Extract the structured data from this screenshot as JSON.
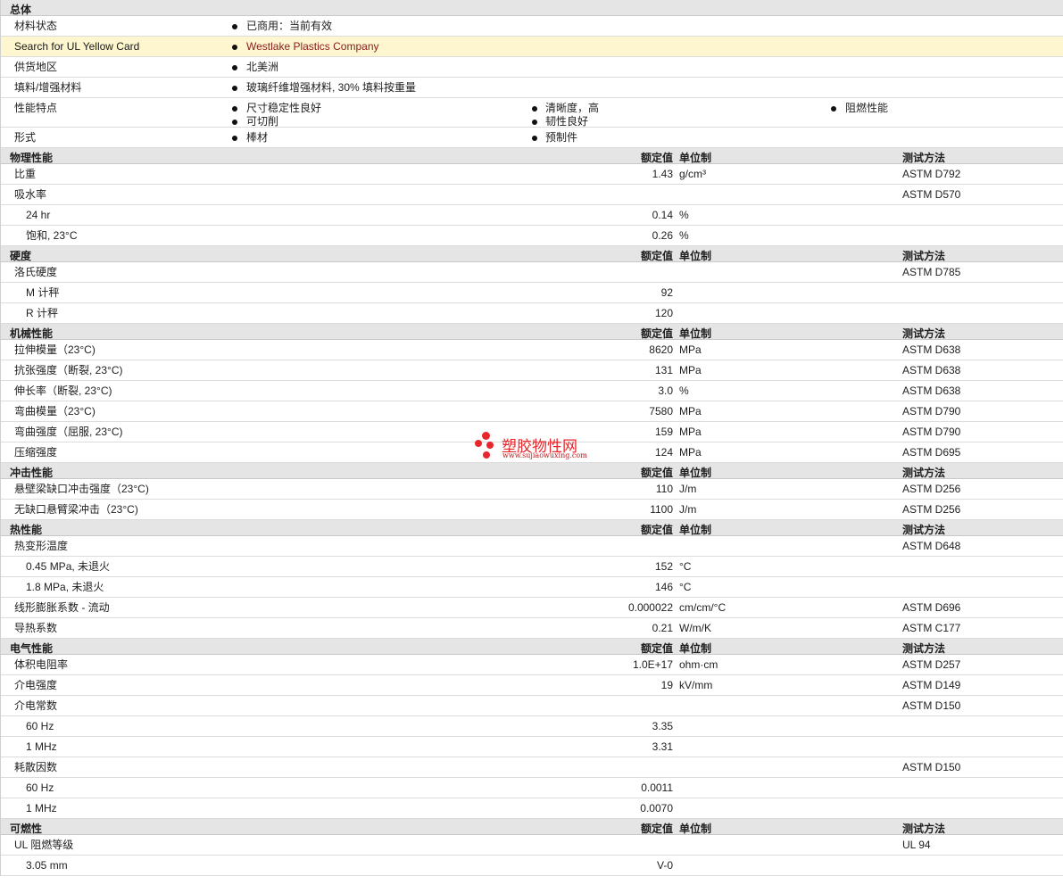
{
  "general": {
    "header": "总体",
    "rows": [
      {
        "label": "材料状态",
        "items": [
          "已商用：当前有效"
        ]
      },
      {
        "label": "Search for UL Yellow Card",
        "items": [
          "Westlake Plastics Company"
        ],
        "highlight": true
      },
      {
        "label": "供货地区",
        "items": [
          "北美洲"
        ]
      },
      {
        "label": "填料/增强材料",
        "items": [
          "玻璃纤维增强材料, 30% 填料按重量"
        ]
      },
      {
        "label": "性能特点",
        "items": [
          "尺寸稳定性良好",
          "清晰度，高",
          "阻燃性能",
          "可切削",
          "韧性良好"
        ]
      },
      {
        "label": "形式",
        "items": [
          "棒材",
          "预制件"
        ]
      }
    ]
  },
  "column_headers": {
    "value": "额定值",
    "unit": "单位制",
    "method": "测试方法"
  },
  "sections": [
    {
      "title": "物理性能",
      "rows": [
        {
          "label": "比重",
          "value": "1.43",
          "unit": "g/cm³",
          "method": "ASTM D792"
        },
        {
          "label": "吸水率",
          "value": "",
          "unit": "",
          "method": "ASTM D570"
        },
        {
          "label": "24 hr",
          "value": "0.14",
          "unit": "%",
          "method": "",
          "sub": true
        },
        {
          "label": "饱和, 23°C",
          "value": "0.26",
          "unit": "%",
          "method": "",
          "sub": true
        }
      ]
    },
    {
      "title": "硬度",
      "rows": [
        {
          "label": "洛氏硬度",
          "value": "",
          "unit": "",
          "method": "ASTM D785"
        },
        {
          "label": "M 计秤",
          "value": "92",
          "unit": "",
          "method": "",
          "sub": true
        },
        {
          "label": "R 计秤",
          "value": "120",
          "unit": "",
          "method": "",
          "sub": true
        }
      ]
    },
    {
      "title": "机械性能",
      "rows": [
        {
          "label": "拉伸模量（23°C)",
          "value": "8620",
          "unit": "MPa",
          "method": "ASTM D638"
        },
        {
          "label": "抗张强度（断裂, 23°C)",
          "value": "131",
          "unit": "MPa",
          "method": "ASTM D638"
        },
        {
          "label": "伸长率（断裂, 23°C)",
          "value": "3.0",
          "unit": "%",
          "method": "ASTM D638"
        },
        {
          "label": "弯曲模量（23°C)",
          "value": "7580",
          "unit": "MPa",
          "method": "ASTM D790"
        },
        {
          "label": "弯曲强度（屈服, 23°C)",
          "value": "159",
          "unit": "MPa",
          "method": "ASTM D790"
        },
        {
          "label": "压缩强度",
          "value": "124",
          "unit": "MPa",
          "method": "ASTM D695"
        }
      ]
    },
    {
      "title": "冲击性能",
      "rows": [
        {
          "label": "悬壁梁缺口冲击强度（23°C)",
          "value": "110",
          "unit": "J/m",
          "method": "ASTM D256"
        },
        {
          "label": "无缺口悬臂梁冲击（23°C)",
          "value": "1100",
          "unit": "J/m",
          "method": "ASTM D256"
        }
      ]
    },
    {
      "title": "热性能",
      "rows": [
        {
          "label": "热变形温度",
          "value": "",
          "unit": "",
          "method": "ASTM D648"
        },
        {
          "label": "0.45 MPa, 未退火",
          "value": "152",
          "unit": "°C",
          "method": "",
          "sub": true
        },
        {
          "label": "1.8 MPa, 未退火",
          "value": "146",
          "unit": "°C",
          "method": "",
          "sub": true
        },
        {
          "label": "线形膨胀系数 - 流动",
          "value": "0.000022",
          "unit": "cm/cm/°C",
          "method": "ASTM D696"
        },
        {
          "label": "导热系数",
          "value": "0.21",
          "unit": "W/m/K",
          "method": "ASTM C177"
        }
      ]
    },
    {
      "title": "电气性能",
      "rows": [
        {
          "label": "体积电阻率",
          "value": "1.0E+17",
          "unit": "ohm·cm",
          "method": "ASTM D257"
        },
        {
          "label": "介电强度",
          "value": "19",
          "unit": "kV/mm",
          "method": "ASTM D149"
        },
        {
          "label": "介电常数",
          "value": "",
          "unit": "",
          "method": "ASTM D150"
        },
        {
          "label": "60 Hz",
          "value": "3.35",
          "unit": "",
          "method": "",
          "sub": true
        },
        {
          "label": "1 MHz",
          "value": "3.31",
          "unit": "",
          "method": "",
          "sub": true
        },
        {
          "label": "耗散因数",
          "value": "",
          "unit": "",
          "method": "ASTM D150"
        },
        {
          "label": "60 Hz",
          "value": "0.0011",
          "unit": "",
          "method": "",
          "sub": true
        },
        {
          "label": "1 MHz",
          "value": "0.0070",
          "unit": "",
          "method": "",
          "sub": true
        }
      ]
    },
    {
      "title": "可燃性",
      "rows": [
        {
          "label": "UL 阻燃等级",
          "value": "",
          "unit": "",
          "method": "UL 94"
        },
        {
          "label": "3.05 mm",
          "value": "V-0",
          "unit": "",
          "method": "",
          "sub": true
        }
      ]
    }
  ],
  "watermark": {
    "name": "塑胶物性网",
    "url": "www.sujiaowuxing.com",
    "color": "#e8262b"
  }
}
